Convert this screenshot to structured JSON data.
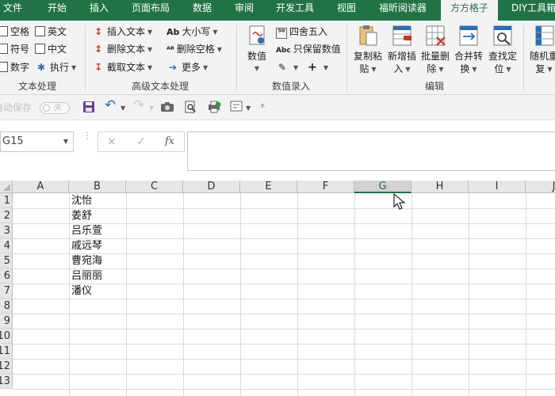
{
  "ribbon_tabs": [
    {
      "label": "文件"
    },
    {
      "label": "开始"
    },
    {
      "label": "插入"
    },
    {
      "label": "页面布局"
    },
    {
      "label": "数据"
    },
    {
      "label": "审阅"
    },
    {
      "label": "开发工具"
    },
    {
      "label": "视图"
    },
    {
      "label": "福昕阅读器"
    },
    {
      "label": "方方格子",
      "active": true
    },
    {
      "label": "DIY工具箱"
    }
  ],
  "groups": {
    "text_processing": {
      "label": "文本处理",
      "checkboxes": [
        "空格",
        "英文",
        "符号",
        "中文",
        "数字"
      ],
      "execute": "执行"
    },
    "advanced_text": {
      "label": "高级文本处理",
      "items": [
        "插入文本",
        "大小写",
        "删除文本",
        "删除空格",
        "截取文本",
        "更多"
      ]
    },
    "numeric_entry": {
      "label": "数值录入",
      "value_button": "数值",
      "round": "四舍五入",
      "keep_values": "只保留数值"
    },
    "edit": {
      "label": "编辑",
      "buttons": [
        {
          "line1": "复制粘",
          "line2": "贴"
        },
        {
          "line1": "新增插",
          "line2": "入"
        },
        {
          "line1": "批量删",
          "line2": "除"
        },
        {
          "line1": "合并转",
          "line2": "换"
        },
        {
          "line1": "查找定",
          "line2": "位"
        }
      ]
    },
    "random": {
      "line1": "随机重",
      "line2": "复"
    }
  },
  "qat": {
    "autosave_label": "自动保存",
    "toggle_state": "关"
  },
  "formula_bar": {
    "name_box": "G15",
    "fx": "fx",
    "cancel": "×",
    "enter": "✓",
    "value": ""
  },
  "sheet": {
    "columns": [
      "A",
      "B",
      "C",
      "D",
      "E",
      "F",
      "G",
      "H",
      "I",
      "J"
    ],
    "selected_column": "G",
    "rows": [
      "1",
      "2",
      "3",
      "4",
      "5",
      "6",
      "7",
      "8",
      "9",
      "10",
      "11",
      "12",
      "13"
    ],
    "column_b": [
      "沈怡",
      "姜舒",
      "吕乐萱",
      "戚远琴",
      "曹宛海",
      "吕丽丽",
      "潘仪"
    ]
  },
  "colors": {
    "excel_green": "#217346",
    "ribbon_bg": "#f3f3f3"
  }
}
